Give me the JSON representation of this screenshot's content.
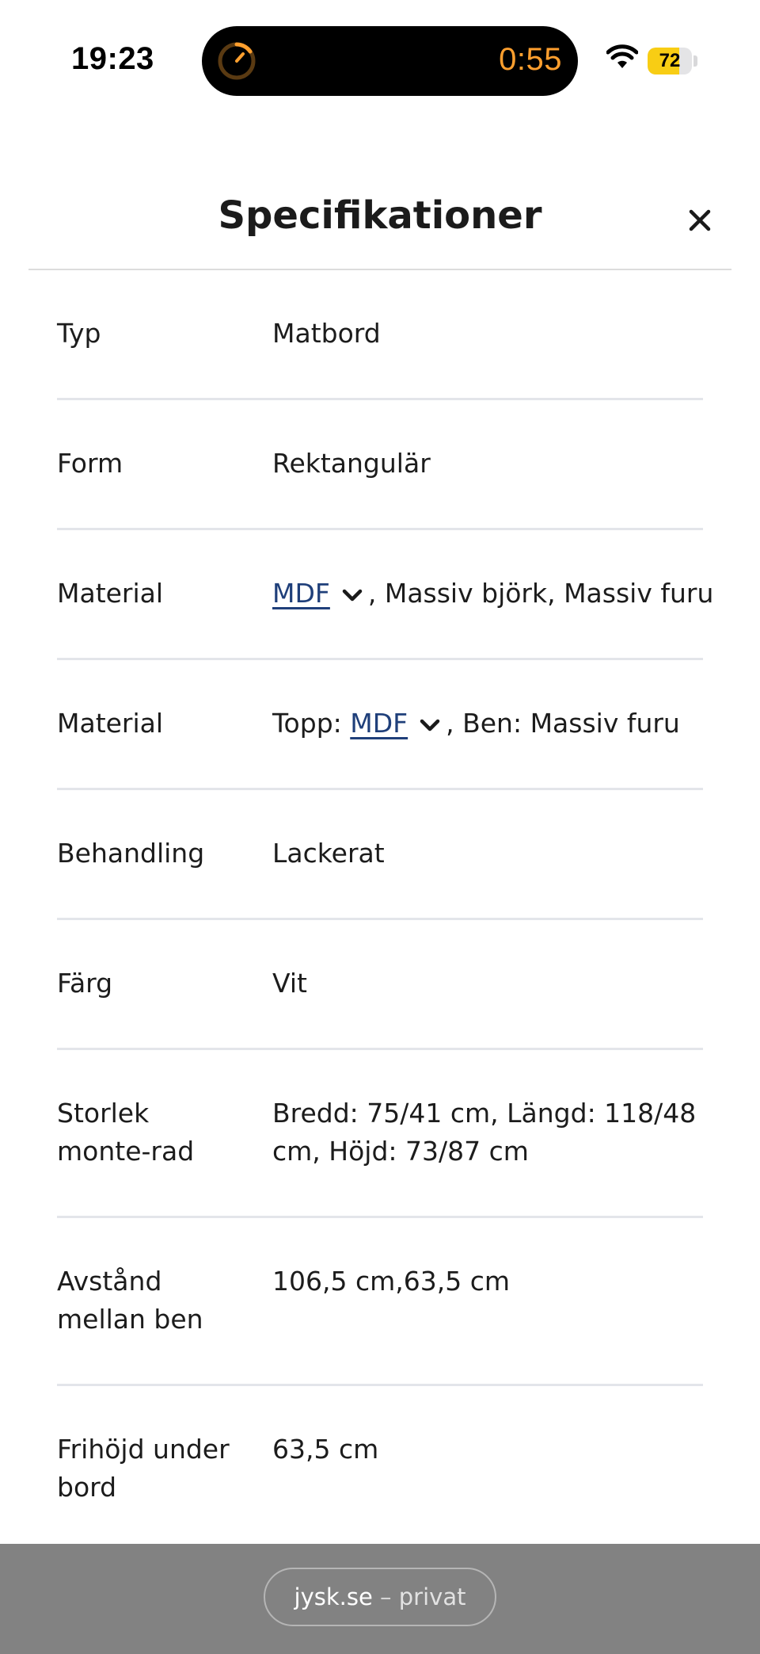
{
  "status_bar": {
    "time": "19:23",
    "timer": "0:55",
    "battery_level": "72",
    "icons": [
      "timer-ring-icon",
      "wifi-icon",
      "battery-icon"
    ]
  },
  "header": {
    "title": "Specifikationer",
    "close_icon": "close-icon"
  },
  "specs": [
    {
      "label": "Typ",
      "value": "Matbord"
    },
    {
      "label": "Form",
      "value": "Rektangulär"
    },
    {
      "label": "Material",
      "link": "MDF",
      "suffix": ", Massiv björk, Massiv furu"
    },
    {
      "label": "Material",
      "prefix": "Topp: ",
      "link": "MDF",
      "suffix": ", Ben: Massiv furu"
    },
    {
      "label": "Behandling",
      "value": "Lackerat"
    },
    {
      "label": "Färg",
      "value": "Vit"
    },
    {
      "label": "Storlek monte-rad",
      "value": "Bredd: 75/41 cm, Längd: 118/48 cm, Höjd: 73/87 cm"
    },
    {
      "label": "Avstånd mellan ben",
      "value": "106,5 cm,63,5 cm"
    },
    {
      "label": "Frihöjd under bord",
      "value": "63,5 cm"
    }
  ],
  "browser_bar": {
    "domain": "jysk.se",
    "separator": "–",
    "mode": "privat"
  },
  "colors": {
    "link": "#1f3f7a",
    "timer": "#ff9f2e",
    "battery": "#f8cd14",
    "bottom_bar": "#828282"
  }
}
